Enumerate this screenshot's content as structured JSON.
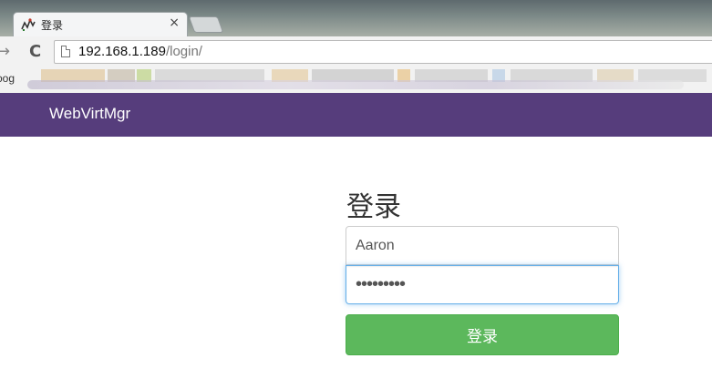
{
  "browser": {
    "tab": {
      "title": "登录",
      "close_glyph": "×",
      "favicon": "webvirtmgr-favicon"
    },
    "toolbar": {
      "back_glyph": "→",
      "reload_glyph": "C",
      "url_host": "192.168.1.189",
      "url_path": "/login/"
    },
    "bookmarks": {
      "label": "oog"
    }
  },
  "navbar": {
    "brand": "WebVirtMgr",
    "color": "#563d7c"
  },
  "login": {
    "title": "登录",
    "username_value": "Aaron",
    "password_value": "•••••••••",
    "submit_label": "登录",
    "submit_color": "#5cb85c",
    "focus_color": "#66afe9"
  }
}
